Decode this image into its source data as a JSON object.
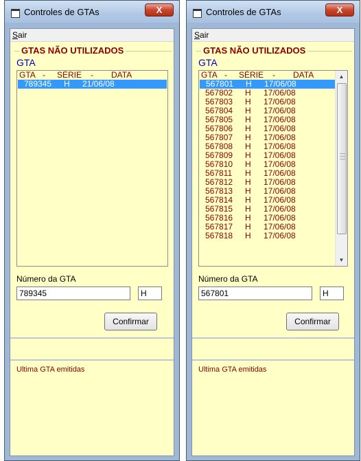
{
  "left": {
    "title": "Controles de GTAs",
    "close_symbol": "X",
    "menu": {
      "sair_hot": "S",
      "sair_rest": "air"
    },
    "group_title": "GTAS NÃO UTILIZADOS",
    "gta_label": "GTA",
    "header": {
      "c1": "GTA",
      "sep1": "-",
      "c2": "SÉRIE",
      "sep2": "-",
      "c3": "DATA"
    },
    "rows": [
      {
        "gta": "789345",
        "serie": "H",
        "data": "21/06/08",
        "selected": true
      }
    ],
    "numero_label": "Número da GTA",
    "numero_value": "789345",
    "serie_value": "H",
    "confirm_label": "Confirmar",
    "ultima_label": "Ultima  GTA emitidas"
  },
  "right": {
    "title": "Controles de GTAs",
    "close_symbol": "X",
    "menu": {
      "sair_hot": "S",
      "sair_rest": "air"
    },
    "group_title": "GTAS NÃO UTILIZADOS",
    "gta_label": "GTA",
    "header": {
      "c1": "GTA",
      "sep1": "-",
      "c2": "SÉRIE",
      "sep2": "-",
      "c3": "DATA"
    },
    "rows": [
      {
        "gta": "567801",
        "serie": "H",
        "data": "17/06/08",
        "selected": true
      },
      {
        "gta": "567802",
        "serie": "H",
        "data": "17/06/08"
      },
      {
        "gta": "567803",
        "serie": "H",
        "data": "17/06/08"
      },
      {
        "gta": "567804",
        "serie": "H",
        "data": "17/06/08"
      },
      {
        "gta": "567805",
        "serie": "H",
        "data": "17/06/08"
      },
      {
        "gta": "567806",
        "serie": "H",
        "data": "17/06/08"
      },
      {
        "gta": "567807",
        "serie": "H",
        "data": "17/06/08"
      },
      {
        "gta": "567808",
        "serie": "H",
        "data": "17/06/08"
      },
      {
        "gta": "567809",
        "serie": "H",
        "data": "17/06/08"
      },
      {
        "gta": "567810",
        "serie": "H",
        "data": "17/06/08"
      },
      {
        "gta": "567811",
        "serie": "H",
        "data": "17/06/08"
      },
      {
        "gta": "567812",
        "serie": "H",
        "data": "17/06/08"
      },
      {
        "gta": "567813",
        "serie": "H",
        "data": "17/06/08"
      },
      {
        "gta": "567814",
        "serie": "H",
        "data": "17/06/08"
      },
      {
        "gta": "567815",
        "serie": "H",
        "data": "17/06/08"
      },
      {
        "gta": "567816",
        "serie": "H",
        "data": "17/06/08"
      },
      {
        "gta": "567817",
        "serie": "H",
        "data": "17/06/08"
      },
      {
        "gta": "567818",
        "serie": "H",
        "data": "17/06/08"
      }
    ],
    "numero_label": "Número da GTA",
    "numero_value": "567801",
    "serie_value": "H",
    "confirm_label": "Confirmar",
    "ultima_label": "Ultima  GTA emitidas"
  },
  "colors": {
    "panel_bg": "#ffffc6",
    "dark_red_text": "#8b0000",
    "gta_blue": "#0000c0",
    "selection": "#3399ff",
    "close_red": "#c9462d"
  },
  "icons": [
    "window-app-icon",
    "close-icon",
    "scroll-up-arrow-icon",
    "scroll-down-arrow-icon"
  ]
}
